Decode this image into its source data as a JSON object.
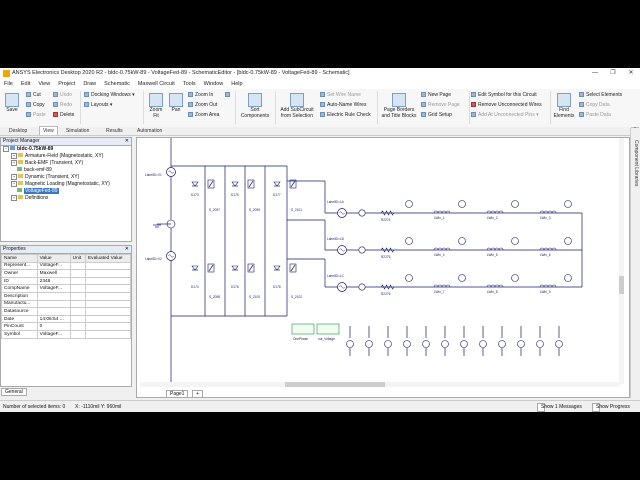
{
  "window": {
    "title": "ANSYS Electronics Desktop 2020 R2 - bldc-0.75kW-89 - VoltageFed-89 - SchematicEditor - [bldc-0.75kW-89 - VoltageFed-89 - Schematic]",
    "minimize": "—",
    "restore": "❐",
    "close": "✕"
  },
  "menu": [
    "File",
    "Edit",
    "View",
    "Project",
    "Draw",
    "Schematic",
    "Maxwell Circuit",
    "Tools",
    "Window",
    "Help"
  ],
  "ribbon": {
    "save": "Save",
    "cut": "Cut",
    "copy": "Copy",
    "paste": "Paste",
    "undo": "Undo",
    "redo": "Redo",
    "delete": "Delete",
    "docking_windows": "Docking Windows",
    "layouts": "Layouts",
    "zoom_fit": "Zoom\nFit",
    "pan": "Pan",
    "zoom_in": "Zoom In",
    "zoom_out": "Zoom Out",
    "zoom_area": "Zoom Area",
    "sort_components": "Sort\nComponents",
    "add_subcircuit": "Add SubCircuit\nfrom Selection",
    "set_wire_name": "Set Wire Name",
    "auto_name_wires": "Auto-Name Wires",
    "electric_rule_check": "Electric Rule Check",
    "page_borders": "Page Borders\nand Title Blocks",
    "new_page": "New Page",
    "remove_page": "Remove Page",
    "grid_setup": "Grid Setup",
    "edit_symbol": "Edit Symbol for this Circuit",
    "remove_unconnected": "Remove Unconnected Wires",
    "add_at_unconnected": "Add At Unconnected Pins",
    "find_elements": "Find\nElements",
    "select_elements": "Select Elements",
    "copy_data": "Copy Data",
    "paste_data": "Paste Data"
  },
  "tabs": [
    {
      "label": "Desktop",
      "active": false
    },
    {
      "label": "View",
      "active": true
    },
    {
      "label": "Simulation",
      "active": false
    },
    {
      "label": "Results",
      "active": false
    },
    {
      "label": "Automation",
      "active": false
    }
  ],
  "project_manager": {
    "title": "Project Manager",
    "root": "bldc-0.75kW-89",
    "items": [
      "Armature-Field (Magnetostatic, XY)",
      "Back-EMF (Transient, XY)",
      "back-emf-89",
      "Dynamic (Transient, XY)",
      "Magnetic Loading (Magnetostatic, XY)",
      "VoltageFed-89",
      "Definitions"
    ],
    "selected": "VoltageFed-89"
  },
  "properties": {
    "title": "Properties",
    "headers": [
      "Name",
      "Value",
      "Unit",
      "Evaluated Value"
    ],
    "rows": [
      [
        "Represent...",
        "VoltageF...",
        "",
        ""
      ],
      [
        "Owner",
        "Maxwell",
        "",
        ""
      ],
      [
        "ID",
        "2348",
        "",
        ""
      ],
      [
        "CompName",
        "VoltageF...",
        "",
        ""
      ],
      [
        "Description",
        "",
        "",
        ""
      ],
      [
        "Manufactu...",
        "",
        "",
        ""
      ],
      [
        "Datasource",
        "",
        "",
        ""
      ],
      [
        "Date",
        "14:06:54 ...",
        "",
        ""
      ],
      [
        "PinCount",
        "0",
        "",
        ""
      ],
      [
        "Symbol",
        "VoltageF...",
        "",
        ""
      ]
    ],
    "general_tab": "General"
  },
  "canvas": {
    "page_tab": "Page1",
    "add_tab": "+"
  },
  "right_panel": "Component Libraries",
  "warning_glyph": "A",
  "status": {
    "selection": "Number of selected items: 0",
    "coords": "X: -1110mil   Y: 960mil",
    "show_messages": "Show 1 Messages",
    "show_progress": "Show Progress"
  },
  "schematic": {
    "diode_labels": [
      "D173",
      "D174",
      "D175",
      "D176",
      "D177",
      "D178"
    ],
    "switch_labels": [
      "S_2097",
      "S_2098",
      "S_2099",
      "S_2100",
      "S_2101",
      "S_2102"
    ],
    "dc_labels": [
      "LabelID=V1",
      "LabelID=V2"
    ],
    "phase_labels": [
      "LabelID=LA",
      "LabelID=LB",
      "LabelID=LC"
    ],
    "resistor_labels": [
      "R2274",
      "R2275",
      "R2276"
    ],
    "winding_labels": [
      "LWin_1",
      "LWin_2",
      "LWin_3",
      "LWin_4",
      "LWin_5",
      "LWin_6",
      "LWin_7",
      "LWin_8",
      "LWin_9"
    ],
    "blocks": [
      "OnePhase",
      "out_Voltage"
    ]
  }
}
